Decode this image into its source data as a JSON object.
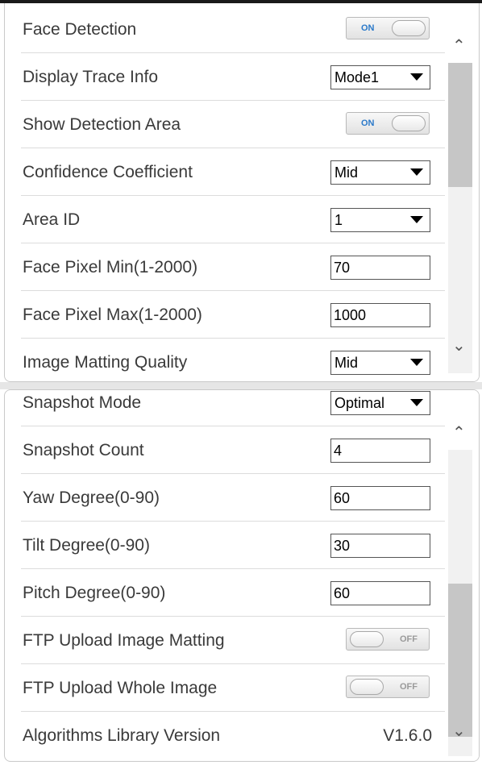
{
  "panel1": {
    "rows": [
      {
        "label": "Face Detection",
        "control": "toggle",
        "state": "ON"
      },
      {
        "label": "Display Trace Info",
        "control": "select",
        "value": "Mode1"
      },
      {
        "label": "Show Detection Area",
        "control": "toggle",
        "state": "ON"
      },
      {
        "label": "Confidence Coefficient",
        "control": "select",
        "value": "Mid"
      },
      {
        "label": "Area ID",
        "control": "select",
        "value": "1"
      },
      {
        "label": "Face Pixel Min(1-2000)",
        "control": "input",
        "value": "70"
      },
      {
        "label": "Face Pixel Max(1-2000)",
        "control": "input",
        "value": "1000"
      },
      {
        "label": "Image Matting Quality",
        "control": "select",
        "value": "Mid"
      }
    ]
  },
  "panel2": {
    "rows": [
      {
        "label": "Snapshot Mode",
        "control": "select",
        "value": "Optimal"
      },
      {
        "label": "Snapshot Count",
        "control": "input",
        "value": "4"
      },
      {
        "label": "Yaw Degree(0-90)",
        "control": "input",
        "value": "60"
      },
      {
        "label": "Tilt Degree(0-90)",
        "control": "input",
        "value": "30"
      },
      {
        "label": "Pitch Degree(0-90)",
        "control": "input",
        "value": "60"
      },
      {
        "label": "FTP Upload Image Matting",
        "control": "toggle",
        "state": "OFF"
      },
      {
        "label": "FTP Upload Whole Image",
        "control": "toggle",
        "state": "OFF"
      },
      {
        "label": "Algorithms Library Version",
        "control": "text",
        "value": "V1.6.0"
      }
    ]
  },
  "icons": {
    "scroll_up": "chevron-up-icon",
    "scroll_down": "chevron-down-icon",
    "select_caret": "caret-down-icon"
  },
  "colors": {
    "toggle_on_text": "#2a79c9",
    "toggle_off_text": "#9a9a9a",
    "scroll_thumb": "#c6c6c6"
  }
}
